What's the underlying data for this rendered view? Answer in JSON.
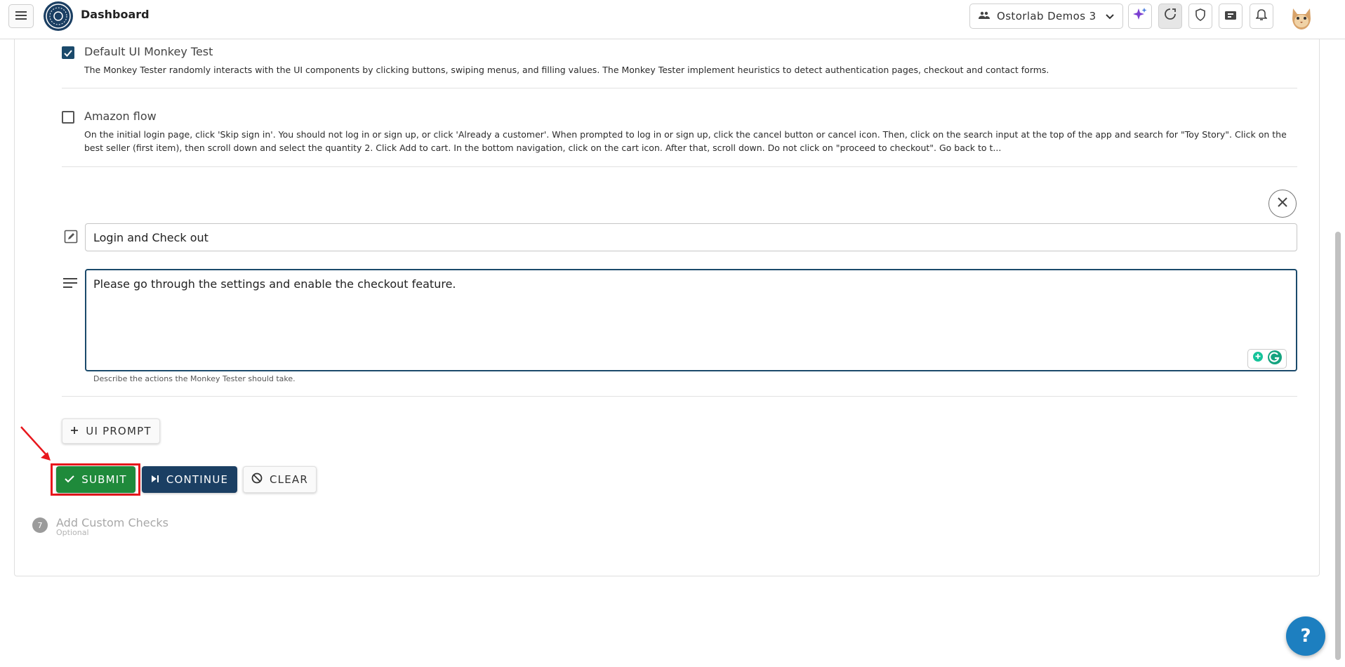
{
  "header": {
    "title": "Dashboard",
    "org_selector": "Ostorlab Demos 3"
  },
  "checks": [
    {
      "title": "Default UI Monkey Test",
      "checked": true,
      "description": "The Monkey Tester randomly interacts with the UI components by clicking buttons, swiping menus, and filling values. The Monkey Tester implement heuristics to detect authentication pages, checkout and contact forms."
    },
    {
      "title": "Amazon flow",
      "checked": false,
      "description": "On the initial login page, click 'Skip sign in'. You should not log in or sign up, or click 'Already a customer'. When prompted to log in or sign up, click the cancel button or cancel icon. Then, click on the search input at the top of the app and search for \"Toy Story\". Click on the best seller (first item), then scroll down and select the quantity 2. Click Add to cart. In the bottom navigation, click on the cart icon. After that, scroll down. Do not click on \"proceed to checkout\". Go back to t..."
    }
  ],
  "custom_prompt": {
    "title_value": "Login and Check out",
    "prompt_value": "Please go through the settings and enable the checkout feature.",
    "helper_text": "Describe the actions the Monkey Tester should take."
  },
  "buttons": {
    "ui_prompt": "UI PROMPT",
    "submit": "SUBMIT",
    "continue": "CONTINUE",
    "clear": "CLEAR"
  },
  "step": {
    "number": "7",
    "title": "Add Custom Checks",
    "subtitle": "Optional"
  },
  "help_fab": "?",
  "colors": {
    "primary": "#1b3f63",
    "submit_green": "#1f8a3b",
    "highlight_red": "#e8171d",
    "help_blue": "#1d7fc0"
  }
}
